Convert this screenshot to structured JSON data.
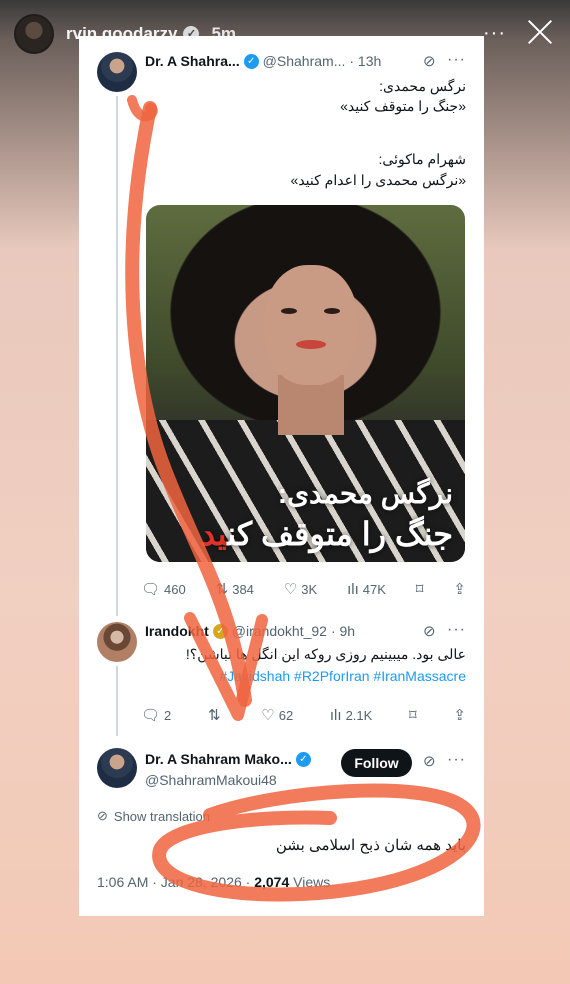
{
  "story": {
    "username": "rvin.goodarzy",
    "time": "5m",
    "more": "···"
  },
  "tweet1": {
    "name": "Dr. A Shahra...",
    "handle": "@Shahram...",
    "time": "· 13h",
    "text_lines": [
      "نرگس محمدی:",
      "«جنگ را متوقف کنید»",
      "شهرام ماکوئی:",
      "«نرگس محمدی را اعدام کنید»"
    ],
    "image_caption_line1": "نرگس محمدی:",
    "image_caption_line2_main": "جنگ را متوقف کن",
    "image_caption_line2_red": "ید",
    "stats": {
      "replies": "460",
      "reposts": "384",
      "likes": "3K",
      "views": "47K"
    }
  },
  "tweet2": {
    "name": "Irandokht",
    "handle": "@irandokht_92",
    "time": "· 9h",
    "text": "عالی بود. میبینیم روزی روکه این انگل ها نباشن؟!",
    "hashtags": "#Javidshah #R2PforIran #IranMassacre",
    "stats": {
      "replies": "2",
      "reposts": "",
      "likes": "62",
      "views": "2.1K"
    }
  },
  "tweet3": {
    "name": "Dr. A Shahram Mako...",
    "handle": "@ShahramMakoui48",
    "follow_label": "Follow",
    "show_translation": "Show translation",
    "text": "باید همه شان ذبح اسلامی بشن",
    "time": "1:06 AM · Jan 28, 2026 · ",
    "views_count": "2,074",
    "views_label": " Views"
  },
  "colors": {
    "verified_blue": "#1d9bf0",
    "verified_gold": "#d9a521",
    "annotation": "#f0643f",
    "text_secondary": "#536471"
  }
}
